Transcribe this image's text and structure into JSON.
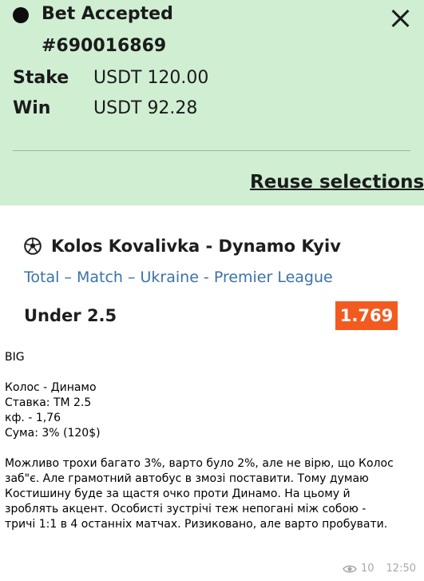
{
  "receipt": {
    "status_title": "Bet Accepted",
    "bet_id": "#690016869",
    "stake_label": "Stake",
    "stake_value": "USDT 120.00",
    "win_label": "Win",
    "win_value": "USDT 92.28",
    "reuse_label": "Reuse selections",
    "close_icon": "close-icon",
    "background_color": "#cfeed2"
  },
  "selection": {
    "sport_icon": "soccer-ball-icon",
    "match": "Kolos Kovalivka - Dynamo Kyiv",
    "market": "Total – Match – Ukraine - Premier League",
    "outcome": "Under 2.5",
    "odds": "1.769",
    "odds_color": "#f35a20",
    "market_color": "#3a73a8"
  },
  "message": {
    "lines_block1": [
      "BIG"
    ],
    "lines_block2": [
      "Колос - Динамо",
      "Ставка: ТМ 2.5",
      "кф. - 1,76",
      "Сума: 3% (120$)"
    ],
    "lines_block3": [
      "Можливо трохи багато 3%, варто було 2%, але не вірю, що Колос",
      "заб\"є. Але грамотний автобус в змозі поставити. Тому думаю",
      "Костишину буде за щастя очко проти Динамо. На цьому й",
      "зроблять акцент. Особисті зустрічі теж непогані між собою -",
      "тричі 1:1 в 4 останніх матчах. Ризиковано, але варто пробувати."
    ]
  },
  "meta": {
    "views_icon": "eye-icon",
    "views": "10",
    "time": "12:50"
  }
}
